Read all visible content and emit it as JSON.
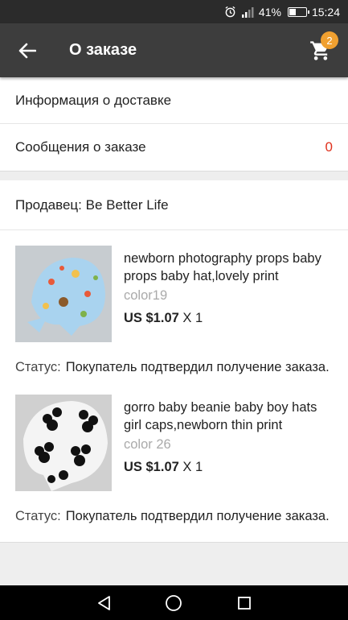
{
  "status_bar": {
    "battery": "41%",
    "time": "15:24",
    "battery_level": 0.41
  },
  "app_bar": {
    "title": "О заказе",
    "cart_count": "2"
  },
  "order": {
    "delivery_info": "Информация о доставке",
    "messages_label": "Сообщения о заказе",
    "messages_count": "0",
    "seller": "Продавец: Be Better Life"
  },
  "items": [
    {
      "title": "newborn photography props baby props baby hat,lovely print",
      "color": "color19",
      "price": "US $1.07",
      "qty": "X 1",
      "status_label": "Статус:",
      "status_text": "Покупатель подтвердил получение заказа."
    },
    {
      "title": "gorro baby beanie baby boy hats girl caps,newborn thin print",
      "color": "color 26",
      "price": "US $1.07",
      "qty": "X 1",
      "status_label": "Статус:",
      "status_text": "Покупатель подтвердил получение заказа."
    }
  ],
  "colors": {
    "app_bar": "#3d3d3d",
    "badge": "#f0a030",
    "count_red": "#e0311d"
  }
}
